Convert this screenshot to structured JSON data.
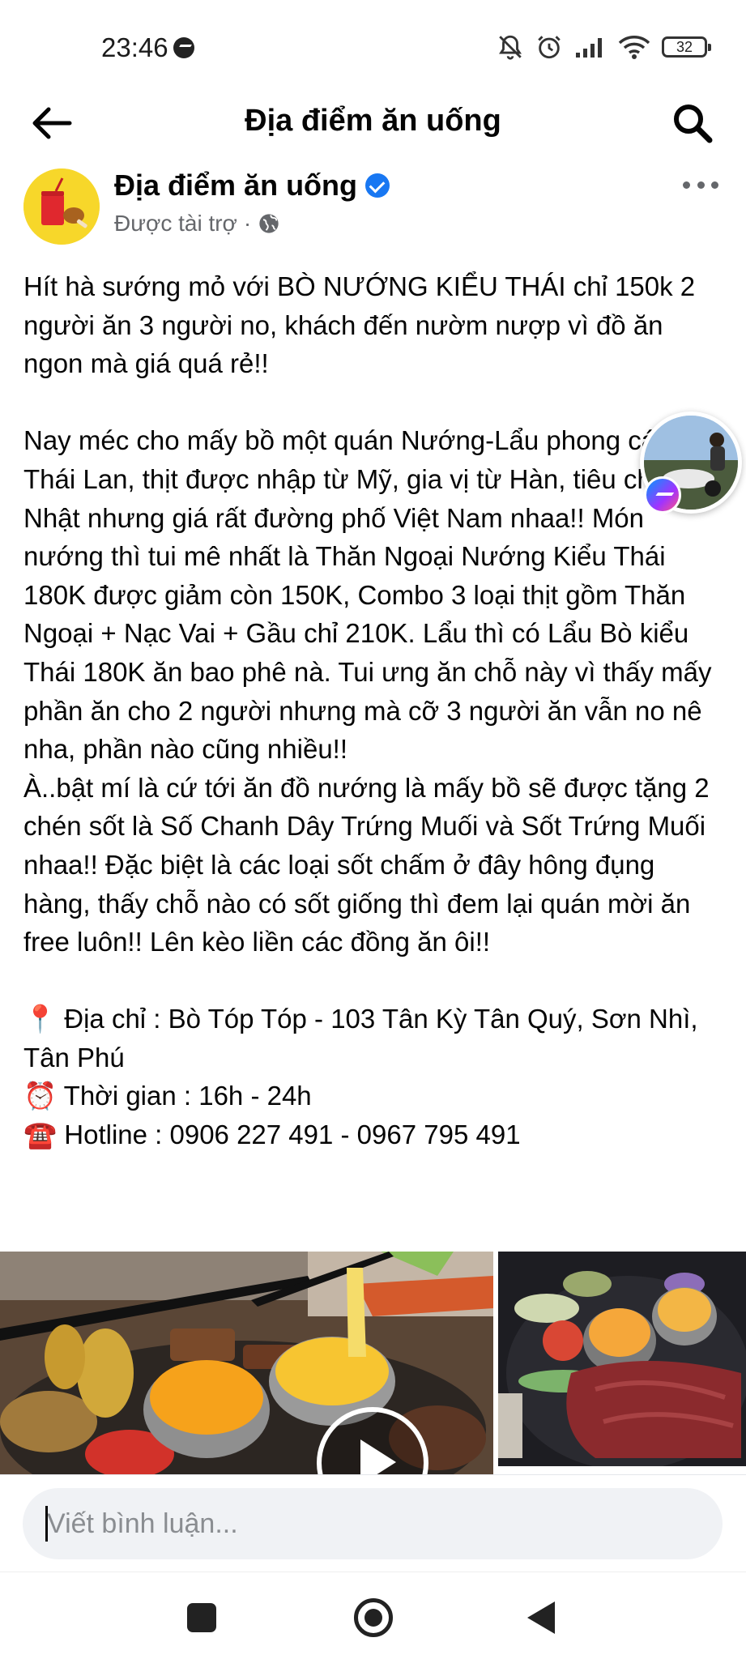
{
  "status_bar": {
    "time": "23:46",
    "battery": "32",
    "icons": [
      "messenger-icon",
      "mute-icon",
      "alarm-icon",
      "signal-icon",
      "wifi-icon",
      "battery-icon"
    ]
  },
  "header": {
    "title": "Địa điểm ăn uống",
    "back_icon": "arrow-left-icon",
    "search_icon": "search-icon"
  },
  "post": {
    "page_name": "Địa điểm ăn uống",
    "verified": true,
    "sponsored_label": "Được tài trợ",
    "separator": "·",
    "paragraphs": [
      "Hít hà sướng mỏ với BÒ NƯỚNG KIỂU THÁI chỉ 150k 2 người ăn 3 người no, khách đến nườm nượp vì đồ ăn ngon mà giá quá rẻ!!",
      "Nay méc cho mấy bồ một quán Nướng-Lẩu phong cách Thái Lan, thịt được nhập từ Mỹ, gia vị từ Hàn, tiêu chuẩn Nhật nhưng giá rất đường phố Việt Nam nhaa!! Món nướng thì tui mê nhất là Thăn Ngoại Nướng Kiểu Thái 180K được giảm còn 150K, Combo 3 loại thịt gồm Thăn Ngoại + Nạc Vai + Gầu chỉ 210K. Lẩu thì có Lẩu Bò kiểu Thái 180K ăn bao phê nà. Tui ưng ăn chỗ này vì thấy mấy phần ăn cho 2 người nhưng mà cỡ 3 người ăn vẫn no nê nha, phần nào cũng nhiều!!",
      "À..bật mí là cứ tới ăn đồ nướng là mấy bồ sẽ được tặng 2 chén sốt là Số Chanh Dây Trứng Muối và Sốt Trứng Muối nhaa!! Đặc biệt là các loại sốt chấm ở đây hông đụng hàng, thấy chỗ nào có sốt giống thì đem lại quán mời ăn free luôn!! Lên kèo liền các đồng ăn ôi!!"
    ],
    "details": [
      {
        "emoji": "📍",
        "text": "Địa chỉ : Bò Tóp Tóp - 103 Tân Kỳ Tân Quý, Sơn Nhì, Tân Phú"
      },
      {
        "emoji": "⏰",
        "text": "Thời gian : 16h - 24h"
      },
      {
        "emoji": "☎️",
        "text": "Hotline : 0906 227 491 - 0967 795 491"
      }
    ]
  },
  "comment": {
    "placeholder": "Viết bình luận..."
  },
  "colors": {
    "facebook_blue": "#1877f2",
    "secondary_text": "#65676b",
    "input_bg": "#f0f2f5"
  }
}
